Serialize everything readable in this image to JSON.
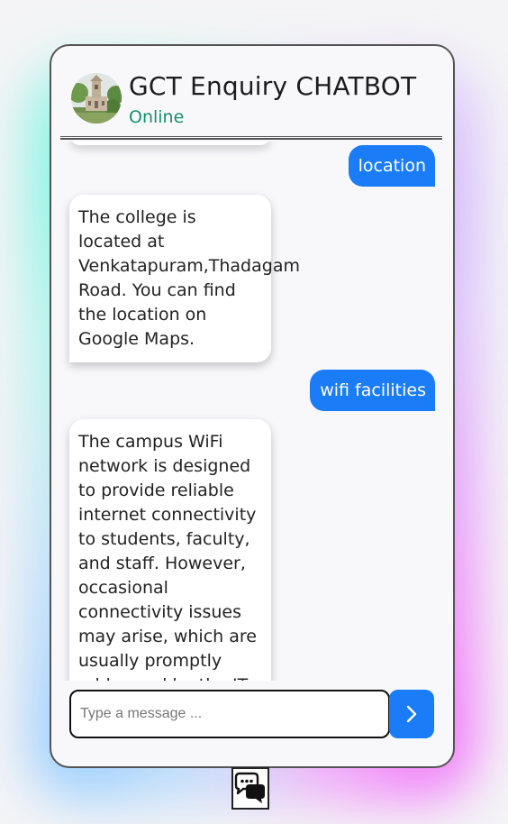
{
  "header": {
    "title": "GCT Enquiry CHATBOT",
    "status": "Online",
    "avatar_icon": "college-building-avatar"
  },
  "messages": [
    {
      "sender": "user",
      "text": "location"
    },
    {
      "sender": "bot",
      "text": "The college is located at Venkatapuram,Thadagam Road. You can find the location on Google Maps."
    },
    {
      "sender": "user",
      "text": "wifi facilities"
    },
    {
      "sender": "bot",
      "text": "The campus WiFi network is designed to provide reliable internet connectivity to students, faculty, and staff. However, occasional connectivity issues may arise, which are usually promptly addressed by the IT department."
    }
  ],
  "input": {
    "placeholder": "Type a message ...",
    "value": ""
  },
  "icons": {
    "send": "chevron-right-icon",
    "toggle": "chat-bubbles-icon"
  },
  "colors": {
    "accent": "#1a7cf7",
    "status": "#15906e",
    "bot_bubble": "#ffffff",
    "window_bg": "#f8f8fb"
  }
}
